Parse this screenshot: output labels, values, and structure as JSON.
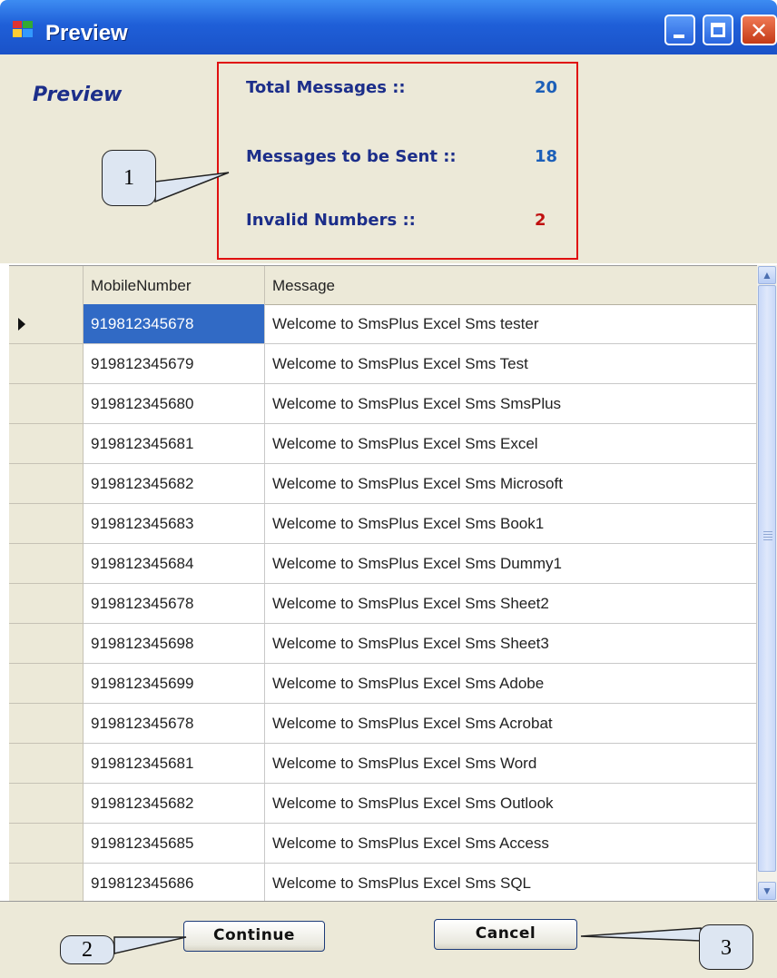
{
  "window": {
    "title": "Preview"
  },
  "panel": {
    "heading": "Preview",
    "stats": [
      {
        "label": "Total Messages ::",
        "value": "20"
      },
      {
        "label": "Messages to be Sent ::",
        "value": "18"
      },
      {
        "label": "Invalid Numbers ::",
        "value": "2"
      }
    ],
    "colors": {
      "label": "#1c2e8a",
      "value": "#1c5fb8",
      "invalid": "#c01010",
      "highlight_border": "#e01010"
    }
  },
  "grid": {
    "columns": [
      "MobileNumber",
      "Message"
    ],
    "rows": [
      [
        "919812345678",
        "Welcome to SmsPlus Excel Sms tester"
      ],
      [
        "919812345679",
        "Welcome to SmsPlus Excel Sms Test"
      ],
      [
        "919812345680",
        "Welcome to SmsPlus Excel Sms SmsPlus"
      ],
      [
        "919812345681",
        "Welcome to SmsPlus Excel Sms Excel"
      ],
      [
        "919812345682",
        "Welcome to SmsPlus Excel Sms Microsoft"
      ],
      [
        "919812345683",
        "Welcome to SmsPlus Excel Sms Book1"
      ],
      [
        "919812345684",
        "Welcome to SmsPlus Excel Sms Dummy1"
      ],
      [
        "919812345678",
        "Welcome to SmsPlus Excel Sms Sheet2"
      ],
      [
        "919812345698",
        "Welcome to SmsPlus Excel Sms Sheet3"
      ],
      [
        "919812345699",
        "Welcome to SmsPlus Excel Sms Adobe"
      ],
      [
        "919812345678",
        "Welcome to SmsPlus Excel Sms Acrobat"
      ],
      [
        "919812345681",
        "Welcome to SmsPlus Excel Sms Word"
      ],
      [
        "919812345682",
        "Welcome to SmsPlus Excel Sms Outlook"
      ],
      [
        "919812345685",
        "Welcome to SmsPlus Excel Sms Access"
      ],
      [
        "919812345686",
        "Welcome to SmsPlus Excel Sms SQL"
      ]
    ],
    "selected_row": 0
  },
  "buttons": {
    "continue": "Continue",
    "cancel": "Cancel"
  },
  "callouts": [
    "1",
    "2",
    "3"
  ]
}
